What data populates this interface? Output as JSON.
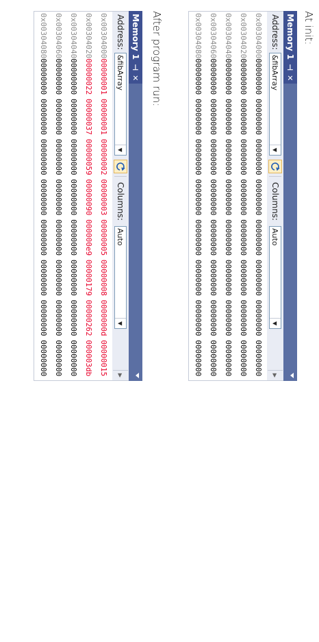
{
  "captions": {
    "init": "At init:",
    "after": "After program run:"
  },
  "panels": [
    {
      "title": "Memory 1",
      "pin_glyph": "⊣",
      "close_glyph": "✕",
      "address_label": "Address:",
      "address_value": "&fibArray",
      "columns_label": "Columns:",
      "columns_value": "Auto",
      "rows": [
        {
          "address": "0x00304000",
          "cells": [
            "00000000",
            "00000000",
            "00000000",
            "00000000",
            "00000000",
            "00000000",
            "00000000",
            "00000000"
          ]
        },
        {
          "address": "0x00304020",
          "cells": [
            "00000000",
            "00000000",
            "00000000",
            "00000000",
            "00000000",
            "00000000",
            "00000000",
            "00000000"
          ]
        },
        {
          "address": "0x00304040",
          "cells": [
            "00000000",
            "00000000",
            "00000000",
            "00000000",
            "00000000",
            "00000000",
            "00000000",
            "00000000"
          ]
        },
        {
          "address": "0x00304060",
          "cells": [
            "00000000",
            "00000000",
            "00000000",
            "00000000",
            "00000000",
            "00000000",
            "00000000",
            "00000000"
          ]
        },
        {
          "address": "0x00304080",
          "cells": [
            "00000000",
            "00000000",
            "00000000",
            "00000000",
            "00000000",
            "00000000",
            "00000000",
            "00000000"
          ]
        }
      ]
    },
    {
      "title": "Memory 1",
      "pin_glyph": "⊣",
      "close_glyph": "✕",
      "address_label": "Address:",
      "address_value": "&fibArray",
      "columns_label": "Columns:",
      "columns_value": "Auto",
      "rows": [
        {
          "address": "0x00304000",
          "cells": [
            "00000001",
            "00000001",
            "00000002",
            "00000003",
            "00000005",
            "00000008",
            "0000000d",
            "00000015"
          ],
          "changed": [
            true,
            true,
            true,
            true,
            true,
            true,
            true,
            true
          ]
        },
        {
          "address": "0x00304020",
          "cells": [
            "00000022",
            "00000037",
            "00000059",
            "00000090",
            "000000e9",
            "00000179",
            "00000262",
            "000003db"
          ],
          "changed": [
            true,
            true,
            true,
            true,
            true,
            true,
            true,
            true
          ]
        },
        {
          "address": "0x00304040",
          "cells": [
            "00000000",
            "00000000",
            "00000000",
            "00000000",
            "00000000",
            "00000000",
            "00000000",
            "00000000"
          ]
        },
        {
          "address": "0x00304060",
          "cells": [
            "00000000",
            "00000000",
            "00000000",
            "00000000",
            "00000000",
            "00000000",
            "00000000",
            "00000000"
          ]
        },
        {
          "address": "0x00304080",
          "cells": [
            "00000000",
            "00000000",
            "00000000",
            "00000000",
            "00000000",
            "00000000",
            "00000000",
            "00000000"
          ]
        }
      ]
    }
  ],
  "colors": {
    "title_bar": "#5b6fa3",
    "changed_value": "#e8002a",
    "address_text": "#8a8a8a"
  }
}
